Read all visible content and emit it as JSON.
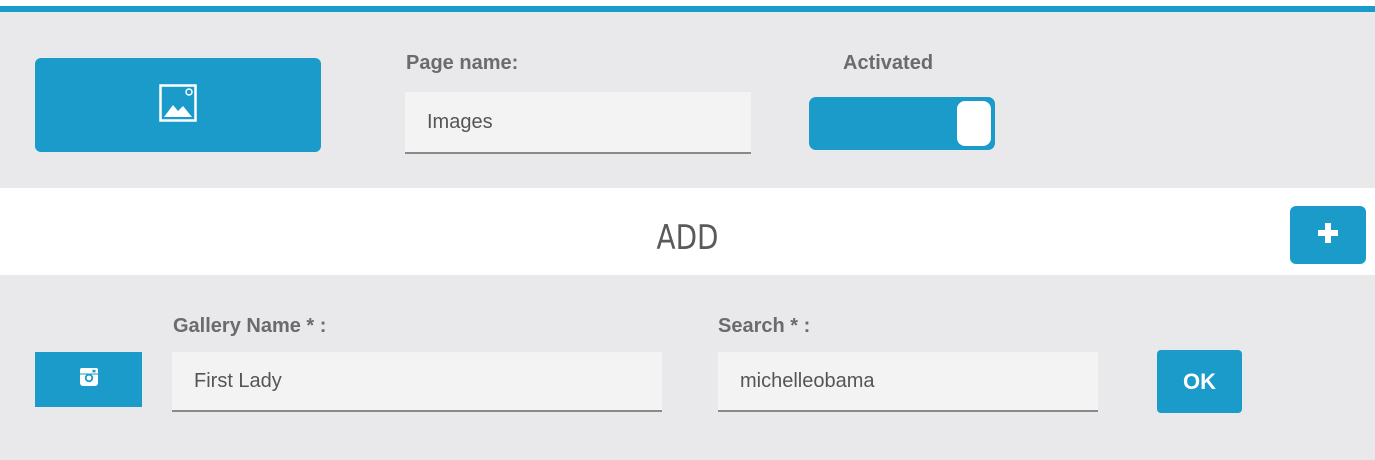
{
  "colors": {
    "accent": "#1a9bc9",
    "panel_background": "#e9e9eb",
    "field_background": "#f3f3f3",
    "label_text": "#6b6b6b"
  },
  "page_settings": {
    "icon": "image-icon",
    "page_name_label": "Page name:",
    "page_name_value": "Images",
    "activated_label": "Activated",
    "activated": true
  },
  "add_section": {
    "heading": "ADD",
    "add_icon": "plus-icon"
  },
  "gallery_entry": {
    "source_icon": "instagram-icon",
    "gallery_name_label": "Gallery Name * :",
    "gallery_name_value": "First Lady",
    "search_label": "Search * :",
    "search_value": "michelleobama",
    "ok_label": "OK"
  }
}
